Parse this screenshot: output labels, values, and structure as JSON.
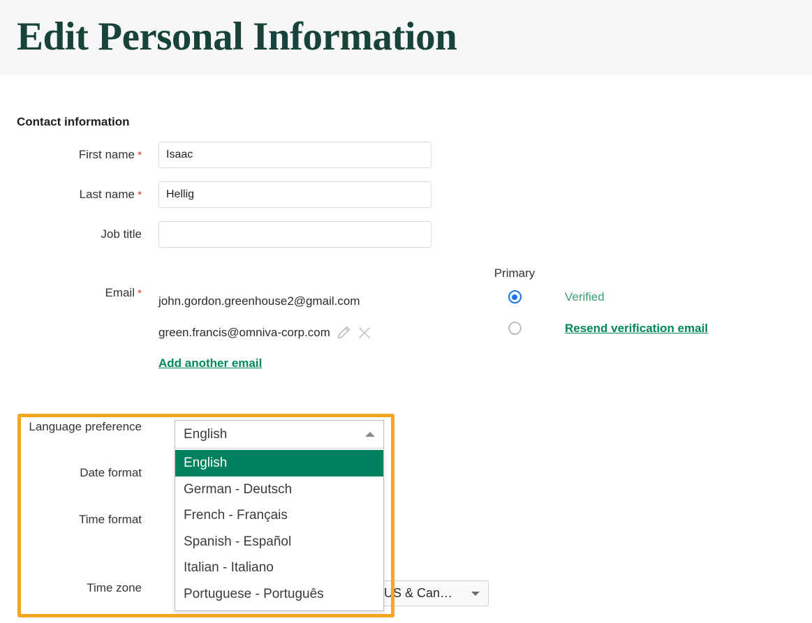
{
  "header": {
    "title": "Edit Personal Information"
  },
  "contact": {
    "section_title": "Contact information",
    "fields": [
      {
        "label": "First name",
        "required": true,
        "value": "Isaac",
        "placeholder": ""
      },
      {
        "label": "Last name",
        "required": true,
        "value": "Hellig",
        "placeholder": ""
      },
      {
        "label": "Job title",
        "required": false,
        "value": "",
        "placeholder": ""
      }
    ],
    "email": {
      "label": "Email",
      "required": true,
      "primary_header": "Primary",
      "rows": [
        {
          "address": "john.gordon.greenhouse2@gmail.com",
          "is_primary": true,
          "status": "Verified",
          "status_type": "verified",
          "has_icons": false
        },
        {
          "address": "green.francis@omniva-corp.com",
          "is_primary": false,
          "status": "Resend verification email",
          "status_type": "link",
          "has_icons": true
        }
      ],
      "add_link": "Add another email"
    }
  },
  "preferences": {
    "rows": [
      {
        "label": "Language preference"
      },
      {
        "label": "Date format"
      },
      {
        "label": "Time format"
      },
      {
        "label": "Time zone"
      }
    ],
    "language_select": {
      "value": "English",
      "expanded": true,
      "options": [
        "English",
        "German - Deutsch",
        "French - Français",
        "Spanish - Español",
        "Italian - Italiano",
        "Portuguese - Português"
      ],
      "selected_index": 0
    },
    "timezone_select": {
      "value": "US & Can…"
    }
  },
  "colors": {
    "title_green": "#17433a",
    "highlight_orange": "#f5a623",
    "option_green": "#00805c",
    "link_green": "#00875a",
    "verified_green": "#3c9e70",
    "radio_blue": "#1a73e8",
    "required_red": "#d93025",
    "header_bg": "#f7f7f7"
  }
}
